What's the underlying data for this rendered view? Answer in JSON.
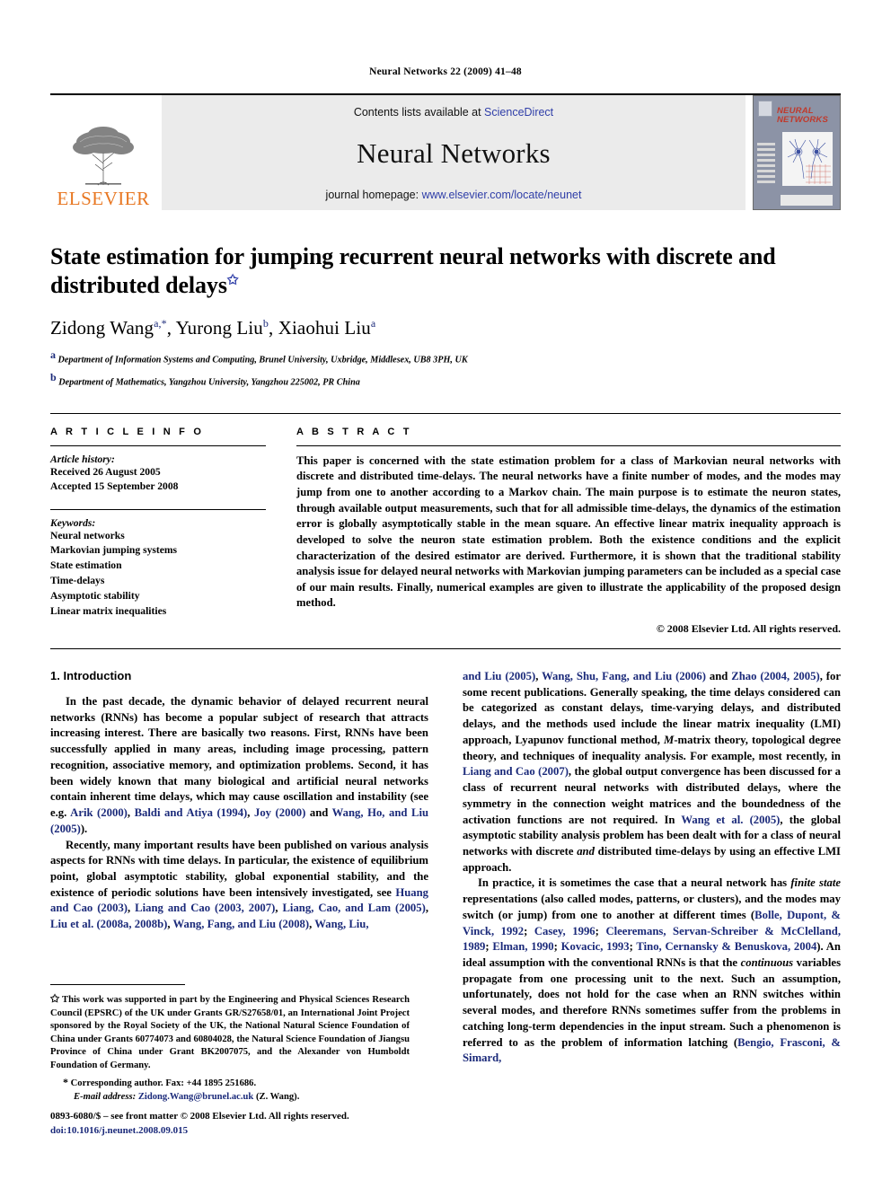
{
  "running_head": "Neural Networks 22 (2009) 41–48",
  "masthead": {
    "publisher": "ELSEVIER",
    "contents_prefix": "Contents lists available at ",
    "contents_link": "ScienceDirect",
    "journal_title": "Neural Networks",
    "homepage_prefix": "journal homepage: ",
    "homepage_link": "www.elsevier.com/locate/neunet",
    "cover_title_line1": "NEURAL",
    "cover_title_line2": "NETWORKS",
    "link_color": "#2f3ea8",
    "elsevier_orange": "#E87722"
  },
  "article": {
    "title": "State estimation for jumping recurrent neural networks with discrete and distributed delays",
    "title_star": "✩",
    "authors": [
      {
        "name": "Zidong Wang",
        "marks": "a,*"
      },
      {
        "name": "Yurong Liu",
        "marks": "b"
      },
      {
        "name": "Xiaohui Liu",
        "marks": "a"
      }
    ],
    "affiliations": [
      {
        "mark": "a",
        "text": "Department of Information Systems and Computing, Brunel University, Uxbridge, Middlesex, UB8 3PH, UK"
      },
      {
        "mark": "b",
        "text": "Department of Mathematics, Yangzhou University, Yangzhou 225002, PR China"
      }
    ]
  },
  "info": {
    "heading": "A R T I C L E     I N F O",
    "history_label": "Article history:",
    "history": [
      "Received 26 August 2005",
      "Accepted 15 September 2008"
    ],
    "keywords_label": "Keywords:",
    "keywords": [
      "Neural networks",
      "Markovian jumping systems",
      "State estimation",
      "Time-delays",
      "Asymptotic stability",
      "Linear matrix inequalities"
    ]
  },
  "abstract": {
    "heading": "A B S T R A C T",
    "text": "This paper is concerned with the state estimation problem for a class of Markovian neural networks with discrete and distributed time-delays. The neural networks have a finite number of modes, and the modes may jump from one to another according to a Markov chain. The main purpose is to estimate the neuron states, through available output measurements, such that for all admissible time-delays, the dynamics of the estimation error is globally asymptotically stable in the mean square. An effective linear matrix inequality approach is developed to solve the neuron state estimation problem. Both the existence conditions and the explicit characterization of the desired estimator are derived. Furthermore, it is shown that the traditional stability analysis issue for delayed neural networks with Markovian jumping parameters can be included as a special case of our main results. Finally, numerical examples are given to illustrate the applicability of the proposed design method.",
    "copyright": "© 2008 Elsevier Ltd. All rights reserved."
  },
  "body": {
    "section_title": "1.  Introduction",
    "left_paragraphs": [
      {
        "id": "p1",
        "runs": [
          {
            "t": "In the past decade, the dynamic behavior of delayed recurrent neural networks (RNNs) has become a popular subject of research that attracts increasing interest. There are basically two reasons. First, RNNs have been successfully applied in many areas, including image processing, pattern recognition, associative memory, and optimization problems. Second, it has been widely known that many biological and artificial neural networks contain inherent time delays, which may cause oscillation and instability (see e.g. ",
            "s": "n"
          },
          {
            "t": "Arik (2000)",
            "s": "c"
          },
          {
            "t": ", ",
            "s": "n"
          },
          {
            "t": "Baldi and Atiya (1994)",
            "s": "c"
          },
          {
            "t": ", ",
            "s": "n"
          },
          {
            "t": "Joy (2000)",
            "s": "c"
          },
          {
            "t": " and ",
            "s": "n"
          },
          {
            "t": "Wang, Ho, and Liu (2005)",
            "s": "c"
          },
          {
            "t": ").",
            "s": "n"
          }
        ]
      },
      {
        "id": "p2",
        "runs": [
          {
            "t": "Recently, many important results have been published on various analysis aspects for RNNs with time delays. In particular, the existence of equilibrium point, global asymptotic stability, global exponential stability, and the existence of periodic solutions have been intensively investigated, see ",
            "s": "n"
          },
          {
            "t": "Huang and Cao (2003)",
            "s": "c"
          },
          {
            "t": ", ",
            "s": "n"
          },
          {
            "t": "Liang and Cao (2003, 2007)",
            "s": "c"
          },
          {
            "t": ", ",
            "s": "n"
          },
          {
            "t": "Liang, Cao, and Lam (2005)",
            "s": "c"
          },
          {
            "t": ", ",
            "s": "n"
          },
          {
            "t": "Liu et al. (2008a, 2008b)",
            "s": "c"
          },
          {
            "t": ", ",
            "s": "n"
          },
          {
            "t": "Wang, Fang, and Liu (2008)",
            "s": "c"
          },
          {
            "t": ", ",
            "s": "n"
          },
          {
            "t": "Wang, Liu,",
            "s": "c"
          }
        ]
      }
    ],
    "right_paragraphs": [
      {
        "id": "p3",
        "runs": [
          {
            "t": "and Liu (2005)",
            "s": "c"
          },
          {
            "t": ", ",
            "s": "n"
          },
          {
            "t": "Wang, Shu, Fang, and Liu (2006)",
            "s": "c"
          },
          {
            "t": " and ",
            "s": "n"
          },
          {
            "t": "Zhao (2004, 2005)",
            "s": "c"
          },
          {
            "t": ", for some recent publications. Generally speaking, the time delays considered can be categorized as constant delays, time-varying delays, and distributed delays, and the methods used include the linear matrix inequality (LMI) approach, Lyapunov functional method, ",
            "s": "n"
          },
          {
            "t": "M",
            "s": "i"
          },
          {
            "t": "-matrix theory, topological degree theory, and techniques of inequality analysis. For example, most recently, in ",
            "s": "n"
          },
          {
            "t": "Liang and Cao (2007)",
            "s": "c"
          },
          {
            "t": ", the global output convergence has been discussed for a class of recurrent neural networks with distributed delays, where the symmetry in the connection weight matrices and the boundedness of the activation functions are not required. In ",
            "s": "n"
          },
          {
            "t": "Wang et al. (2005)",
            "s": "c"
          },
          {
            "t": ", the global asymptotic stability analysis problem has been dealt with for a class of neural networks with discrete ",
            "s": "n"
          },
          {
            "t": "and",
            "s": "i"
          },
          {
            "t": " distributed time-delays by using an effective LMI approach.",
            "s": "n"
          }
        ]
      },
      {
        "id": "p4",
        "runs": [
          {
            "t": "In practice, it is sometimes the case that a neural network has ",
            "s": "n"
          },
          {
            "t": "finite state",
            "s": "i"
          },
          {
            "t": " representations (also called modes, patterns, or clusters), and the modes may switch (or jump) from one to another at different  times (",
            "s": "n"
          },
          {
            "t": "Bolle, Dupont, & Vinck, 1992",
            "s": "c"
          },
          {
            "t": "; ",
            "s": "n"
          },
          {
            "t": "Casey, 1996",
            "s": "c"
          },
          {
            "t": "; ",
            "s": "n"
          },
          {
            "t": "Cleeremans, Servan-Schreiber & McClelland, 1989",
            "s": "c"
          },
          {
            "t": "; ",
            "s": "n"
          },
          {
            "t": "Elman, 1990",
            "s": "c"
          },
          {
            "t": "; ",
            "s": "n"
          },
          {
            "t": "Kovacic, 1993",
            "s": "c"
          },
          {
            "t": "; ",
            "s": "n"
          },
          {
            "t": "Tino, Cernansky & Benuskova, 2004",
            "s": "c"
          },
          {
            "t": "). An ideal assumption with the conventional RNNs is that the ",
            "s": "n"
          },
          {
            "t": "continuous",
            "s": "i"
          },
          {
            "t": " variables propagate from one processing unit to the next. Such an assumption, unfortunately, does not hold for the case when an RNN switches within several modes, and therefore RNNs sometimes suffer from the problems in catching long-term dependencies in the input stream. Such a phenomenon is referred to as the problem of information latching (",
            "s": "n"
          },
          {
            "t": "Bengio, Frasconi, & Simard,",
            "s": "c"
          }
        ]
      }
    ]
  },
  "footnotes": {
    "star_symbol": "✩",
    "funding": "This work was supported in part by the Engineering and Physical Sciences Research Council (EPSRC) of the UK under Grants GR/S27658/01, an International Joint Project sponsored by the Royal Society of the UK, the National Natural Science Foundation of China under Grants 60774073 and 60804028, the Natural Science Foundation of Jiangsu Province of China under Grant BK2007075, and the Alexander von Humboldt Foundation of Germany.",
    "corresponding_symbol": "*",
    "corresponding": "Corresponding author. Fax: +44 1895 251686.",
    "email_label": "E-mail address:",
    "email": "Zidong.Wang@brunel.ac.uk",
    "email_suffix": "(Z. Wang).",
    "issn_line": "0893-6080/$ – see front matter © 2008 Elsevier Ltd. All rights reserved.",
    "doi_line": "doi:10.1016/j.neunet.2008.09.015"
  }
}
